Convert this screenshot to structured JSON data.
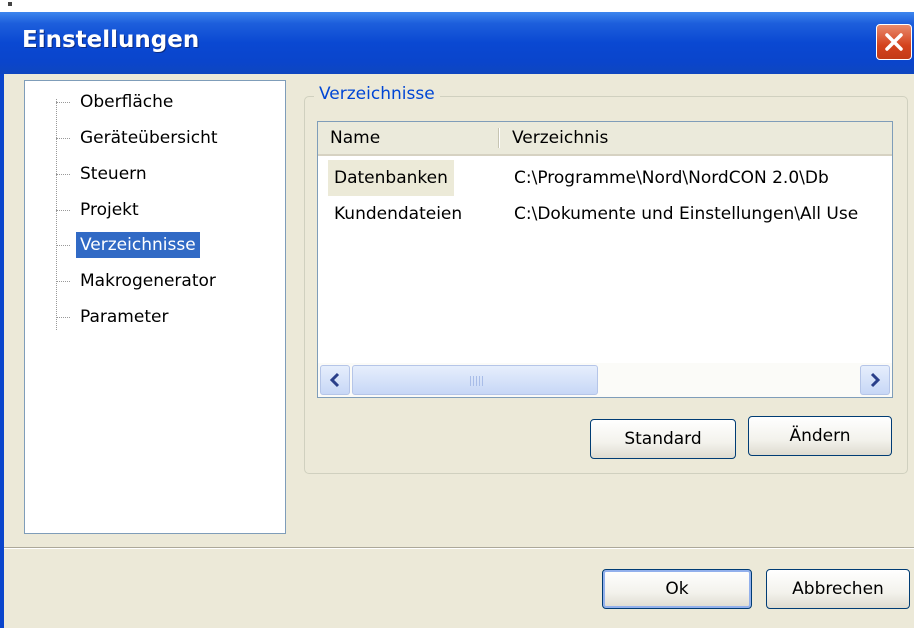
{
  "window": {
    "title": "Einstellungen"
  },
  "tree": {
    "items": [
      {
        "label": "Oberfläche"
      },
      {
        "label": "Geräteübersicht"
      },
      {
        "label": "Steuern"
      },
      {
        "label": "Projekt"
      },
      {
        "label": "Verzeichnisse",
        "selected": true
      },
      {
        "label": "Makrogenerator"
      },
      {
        "label": "Parameter"
      }
    ]
  },
  "group": {
    "title": "Verzeichnisse"
  },
  "list": {
    "columns": [
      "Name",
      "Verzeichnis"
    ],
    "rows": [
      {
        "name": "Datenbanken",
        "path": "C:\\Programme\\Nord\\NordCON 2.0\\Db",
        "selected": true
      },
      {
        "name": "Kundendateien",
        "path": "C:\\Dokumente und Einstellungen\\All Use"
      }
    ]
  },
  "buttons": {
    "standard": "Standard",
    "change": "Ändern",
    "ok": "Ok",
    "cancel": "Abbrechen"
  },
  "icons": {
    "close": "close-icon",
    "scroll_left": "chevron-left-icon",
    "scroll_right": "chevron-right-icon"
  },
  "colors": {
    "titlebar": "#0a48d2",
    "selection": "#316ac5",
    "group_title": "#0046d5",
    "dialog_bg": "#ece9d8"
  }
}
